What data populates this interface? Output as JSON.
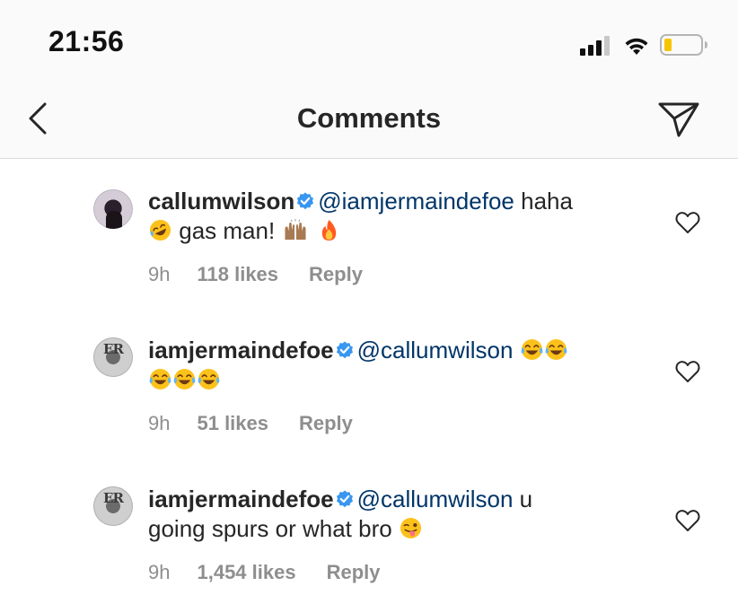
{
  "status_bar": {
    "time": "21:56",
    "icons": [
      "signal-icon",
      "wifi-icon",
      "battery-icon"
    ]
  },
  "header": {
    "title": "Comments",
    "back_icon": "chevron-left-icon",
    "send_icon": "paper-plane-icon"
  },
  "colors": {
    "text": "#262626",
    "secondary": "#8e8e8e",
    "mention": "#003569",
    "verified": "#3897f0",
    "divider": "#dbdbdb",
    "battery_level": "#f7c500"
  },
  "comments": [
    {
      "username": "callumwilson",
      "verified": true,
      "mention": "@iamjermaindefoe",
      "text_a": "haha",
      "text_b": "gas man!",
      "emojis": [
        "rolling-on-floor-laughing-emoji",
        "raising-hands-emoji",
        "fire-emoji"
      ],
      "time": "9h",
      "likes": "118 likes",
      "reply": "Reply"
    },
    {
      "username": "iamjermaindefoe",
      "verified": true,
      "mention": "@callumwilson",
      "emojis": [
        "tears-of-joy-emoji",
        "tears-of-joy-emoji",
        "tears-of-joy-emoji",
        "tears-of-joy-emoji",
        "tears-of-joy-emoji"
      ],
      "time": "9h",
      "likes": "51 likes",
      "reply": "Reply"
    },
    {
      "username": "iamjermaindefoe",
      "verified": true,
      "mention": "@callumwilson",
      "text_a": "u",
      "text_b": "going spurs or what bro",
      "emojis": [
        "winking-face-with-tongue-emoji"
      ],
      "time": "9h",
      "likes": "1,454 likes",
      "reply": "Reply"
    }
  ]
}
